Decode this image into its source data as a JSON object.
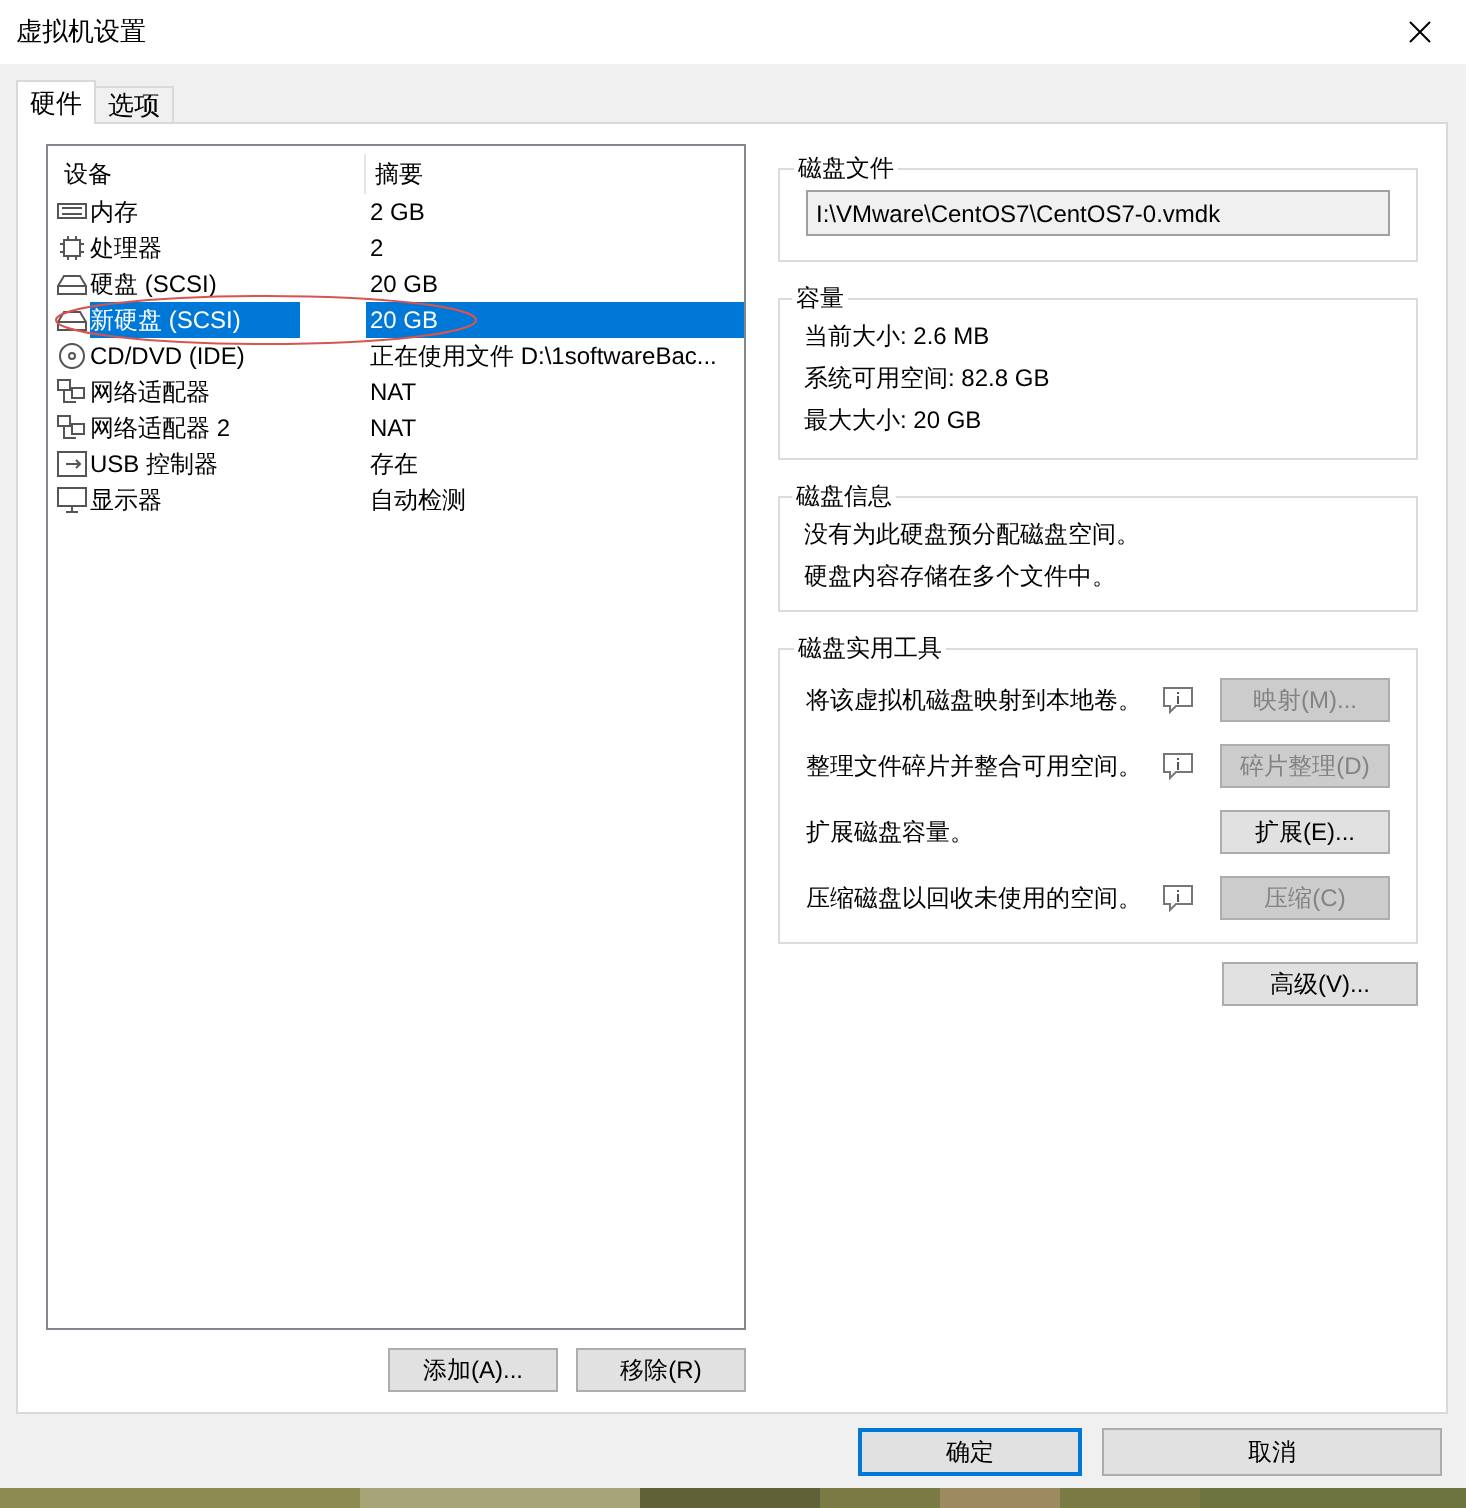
{
  "window": {
    "title": "虚拟机设置"
  },
  "tabs": [
    {
      "label": "硬件",
      "selected": true
    },
    {
      "label": "选项",
      "selected": false
    }
  ],
  "devices": {
    "columns": [
      "设备",
      "摘要"
    ],
    "rows": [
      {
        "kind": "memory",
        "name": "内存",
        "summary": "2 GB",
        "selected": false
      },
      {
        "kind": "cpu",
        "name": "处理器",
        "summary": "2",
        "selected": false
      },
      {
        "kind": "disk",
        "name": "硬盘 (SCSI)",
        "summary": "20 GB",
        "selected": false
      },
      {
        "kind": "disk",
        "name": "新硬盘 (SCSI)",
        "summary": "20 GB",
        "selected": true
      },
      {
        "kind": "cd",
        "name": "CD/DVD (IDE)",
        "summary": "正在使用文件 D:\\1softwareBac...",
        "selected": false
      },
      {
        "kind": "network",
        "name": "网络适配器",
        "summary": "NAT",
        "selected": false
      },
      {
        "kind": "network",
        "name": "网络适配器 2",
        "summary": "NAT",
        "selected": false
      },
      {
        "kind": "usb",
        "name": "USB 控制器",
        "summary": "存在",
        "selected": false
      },
      {
        "kind": "display",
        "name": "显示器",
        "summary": "自动检测",
        "selected": false
      }
    ],
    "buttons": [
      "添加(A)...",
      "移除(R)"
    ]
  },
  "disk_file": {
    "title": "磁盘文件",
    "value": "I:\\VMware\\CentOS7\\CentOS7-0.vmdk"
  },
  "capacity": {
    "title": "容量",
    "lines": [
      "当前大小: 2.6 MB",
      "系统可用空间: 82.8 GB",
      "最大大小: 20 GB"
    ]
  },
  "disk_info": {
    "title": "磁盘信息",
    "lines": [
      "没有为此硬盘预分配磁盘空间。",
      "硬盘内容存储在多个文件中。"
    ]
  },
  "utilities": {
    "title": "磁盘实用工具",
    "rows": [
      {
        "text": "将该虚拟机磁盘映射到本地卷。",
        "info": true,
        "button": "映射(M)...",
        "disabled": true
      },
      {
        "text": "整理文件碎片并整合可用空间。",
        "info": true,
        "button": "碎片整理(D)",
        "disabled": true
      },
      {
        "text": "扩展磁盘容量。",
        "info": false,
        "button": "扩展(E)...",
        "disabled": false
      },
      {
        "text": "压缩磁盘以回收未使用的空间。",
        "info": true,
        "button": "压缩(C)",
        "disabled": true
      }
    ]
  },
  "advanced_button": "高级(V)...",
  "footer_buttons": [
    {
      "label": "确定",
      "default": true
    },
    {
      "label": "取消",
      "default": false
    }
  ]
}
